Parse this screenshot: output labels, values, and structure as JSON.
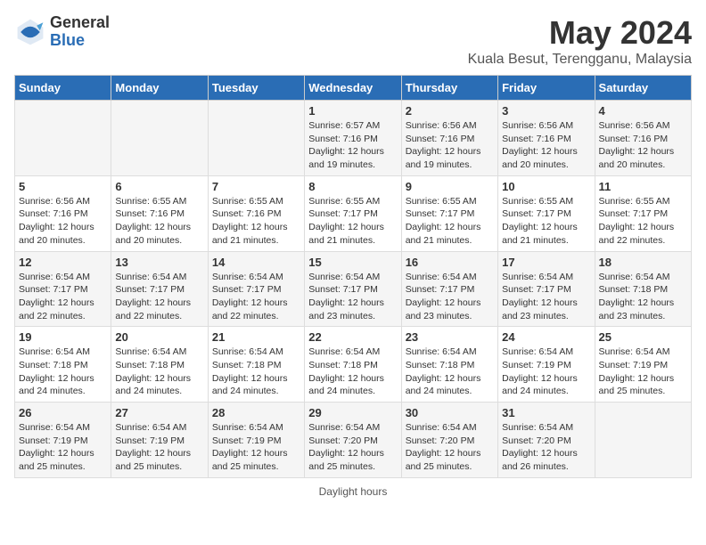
{
  "header": {
    "logo_general": "General",
    "logo_blue": "Blue",
    "title": "May 2024",
    "subtitle": "Kuala Besut, Terengganu, Malaysia"
  },
  "days_of_week": [
    "Sunday",
    "Monday",
    "Tuesday",
    "Wednesday",
    "Thursday",
    "Friday",
    "Saturday"
  ],
  "weeks": [
    [
      {
        "day": "",
        "info": ""
      },
      {
        "day": "",
        "info": ""
      },
      {
        "day": "",
        "info": ""
      },
      {
        "day": "1",
        "info": "Sunrise: 6:57 AM\nSunset: 7:16 PM\nDaylight: 12 hours and 19 minutes."
      },
      {
        "day": "2",
        "info": "Sunrise: 6:56 AM\nSunset: 7:16 PM\nDaylight: 12 hours and 19 minutes."
      },
      {
        "day": "3",
        "info": "Sunrise: 6:56 AM\nSunset: 7:16 PM\nDaylight: 12 hours and 20 minutes."
      },
      {
        "day": "4",
        "info": "Sunrise: 6:56 AM\nSunset: 7:16 PM\nDaylight: 12 hours and 20 minutes."
      }
    ],
    [
      {
        "day": "5",
        "info": "Sunrise: 6:56 AM\nSunset: 7:16 PM\nDaylight: 12 hours and 20 minutes."
      },
      {
        "day": "6",
        "info": "Sunrise: 6:55 AM\nSunset: 7:16 PM\nDaylight: 12 hours and 20 minutes."
      },
      {
        "day": "7",
        "info": "Sunrise: 6:55 AM\nSunset: 7:16 PM\nDaylight: 12 hours and 21 minutes."
      },
      {
        "day": "8",
        "info": "Sunrise: 6:55 AM\nSunset: 7:17 PM\nDaylight: 12 hours and 21 minutes."
      },
      {
        "day": "9",
        "info": "Sunrise: 6:55 AM\nSunset: 7:17 PM\nDaylight: 12 hours and 21 minutes."
      },
      {
        "day": "10",
        "info": "Sunrise: 6:55 AM\nSunset: 7:17 PM\nDaylight: 12 hours and 21 minutes."
      },
      {
        "day": "11",
        "info": "Sunrise: 6:55 AM\nSunset: 7:17 PM\nDaylight: 12 hours and 22 minutes."
      }
    ],
    [
      {
        "day": "12",
        "info": "Sunrise: 6:54 AM\nSunset: 7:17 PM\nDaylight: 12 hours and 22 minutes."
      },
      {
        "day": "13",
        "info": "Sunrise: 6:54 AM\nSunset: 7:17 PM\nDaylight: 12 hours and 22 minutes."
      },
      {
        "day": "14",
        "info": "Sunrise: 6:54 AM\nSunset: 7:17 PM\nDaylight: 12 hours and 22 minutes."
      },
      {
        "day": "15",
        "info": "Sunrise: 6:54 AM\nSunset: 7:17 PM\nDaylight: 12 hours and 23 minutes."
      },
      {
        "day": "16",
        "info": "Sunrise: 6:54 AM\nSunset: 7:17 PM\nDaylight: 12 hours and 23 minutes."
      },
      {
        "day": "17",
        "info": "Sunrise: 6:54 AM\nSunset: 7:17 PM\nDaylight: 12 hours and 23 minutes."
      },
      {
        "day": "18",
        "info": "Sunrise: 6:54 AM\nSunset: 7:18 PM\nDaylight: 12 hours and 23 minutes."
      }
    ],
    [
      {
        "day": "19",
        "info": "Sunrise: 6:54 AM\nSunset: 7:18 PM\nDaylight: 12 hours and 24 minutes."
      },
      {
        "day": "20",
        "info": "Sunrise: 6:54 AM\nSunset: 7:18 PM\nDaylight: 12 hours and 24 minutes."
      },
      {
        "day": "21",
        "info": "Sunrise: 6:54 AM\nSunset: 7:18 PM\nDaylight: 12 hours and 24 minutes."
      },
      {
        "day": "22",
        "info": "Sunrise: 6:54 AM\nSunset: 7:18 PM\nDaylight: 12 hours and 24 minutes."
      },
      {
        "day": "23",
        "info": "Sunrise: 6:54 AM\nSunset: 7:18 PM\nDaylight: 12 hours and 24 minutes."
      },
      {
        "day": "24",
        "info": "Sunrise: 6:54 AM\nSunset: 7:19 PM\nDaylight: 12 hours and 24 minutes."
      },
      {
        "day": "25",
        "info": "Sunrise: 6:54 AM\nSunset: 7:19 PM\nDaylight: 12 hours and 25 minutes."
      }
    ],
    [
      {
        "day": "26",
        "info": "Sunrise: 6:54 AM\nSunset: 7:19 PM\nDaylight: 12 hours and 25 minutes."
      },
      {
        "day": "27",
        "info": "Sunrise: 6:54 AM\nSunset: 7:19 PM\nDaylight: 12 hours and 25 minutes."
      },
      {
        "day": "28",
        "info": "Sunrise: 6:54 AM\nSunset: 7:19 PM\nDaylight: 12 hours and 25 minutes."
      },
      {
        "day": "29",
        "info": "Sunrise: 6:54 AM\nSunset: 7:20 PM\nDaylight: 12 hours and 25 minutes."
      },
      {
        "day": "30",
        "info": "Sunrise: 6:54 AM\nSunset: 7:20 PM\nDaylight: 12 hours and 25 minutes."
      },
      {
        "day": "31",
        "info": "Sunrise: 6:54 AM\nSunset: 7:20 PM\nDaylight: 12 hours and 26 minutes."
      },
      {
        "day": "",
        "info": ""
      }
    ]
  ],
  "footer": {
    "daylight_label": "Daylight hours"
  }
}
